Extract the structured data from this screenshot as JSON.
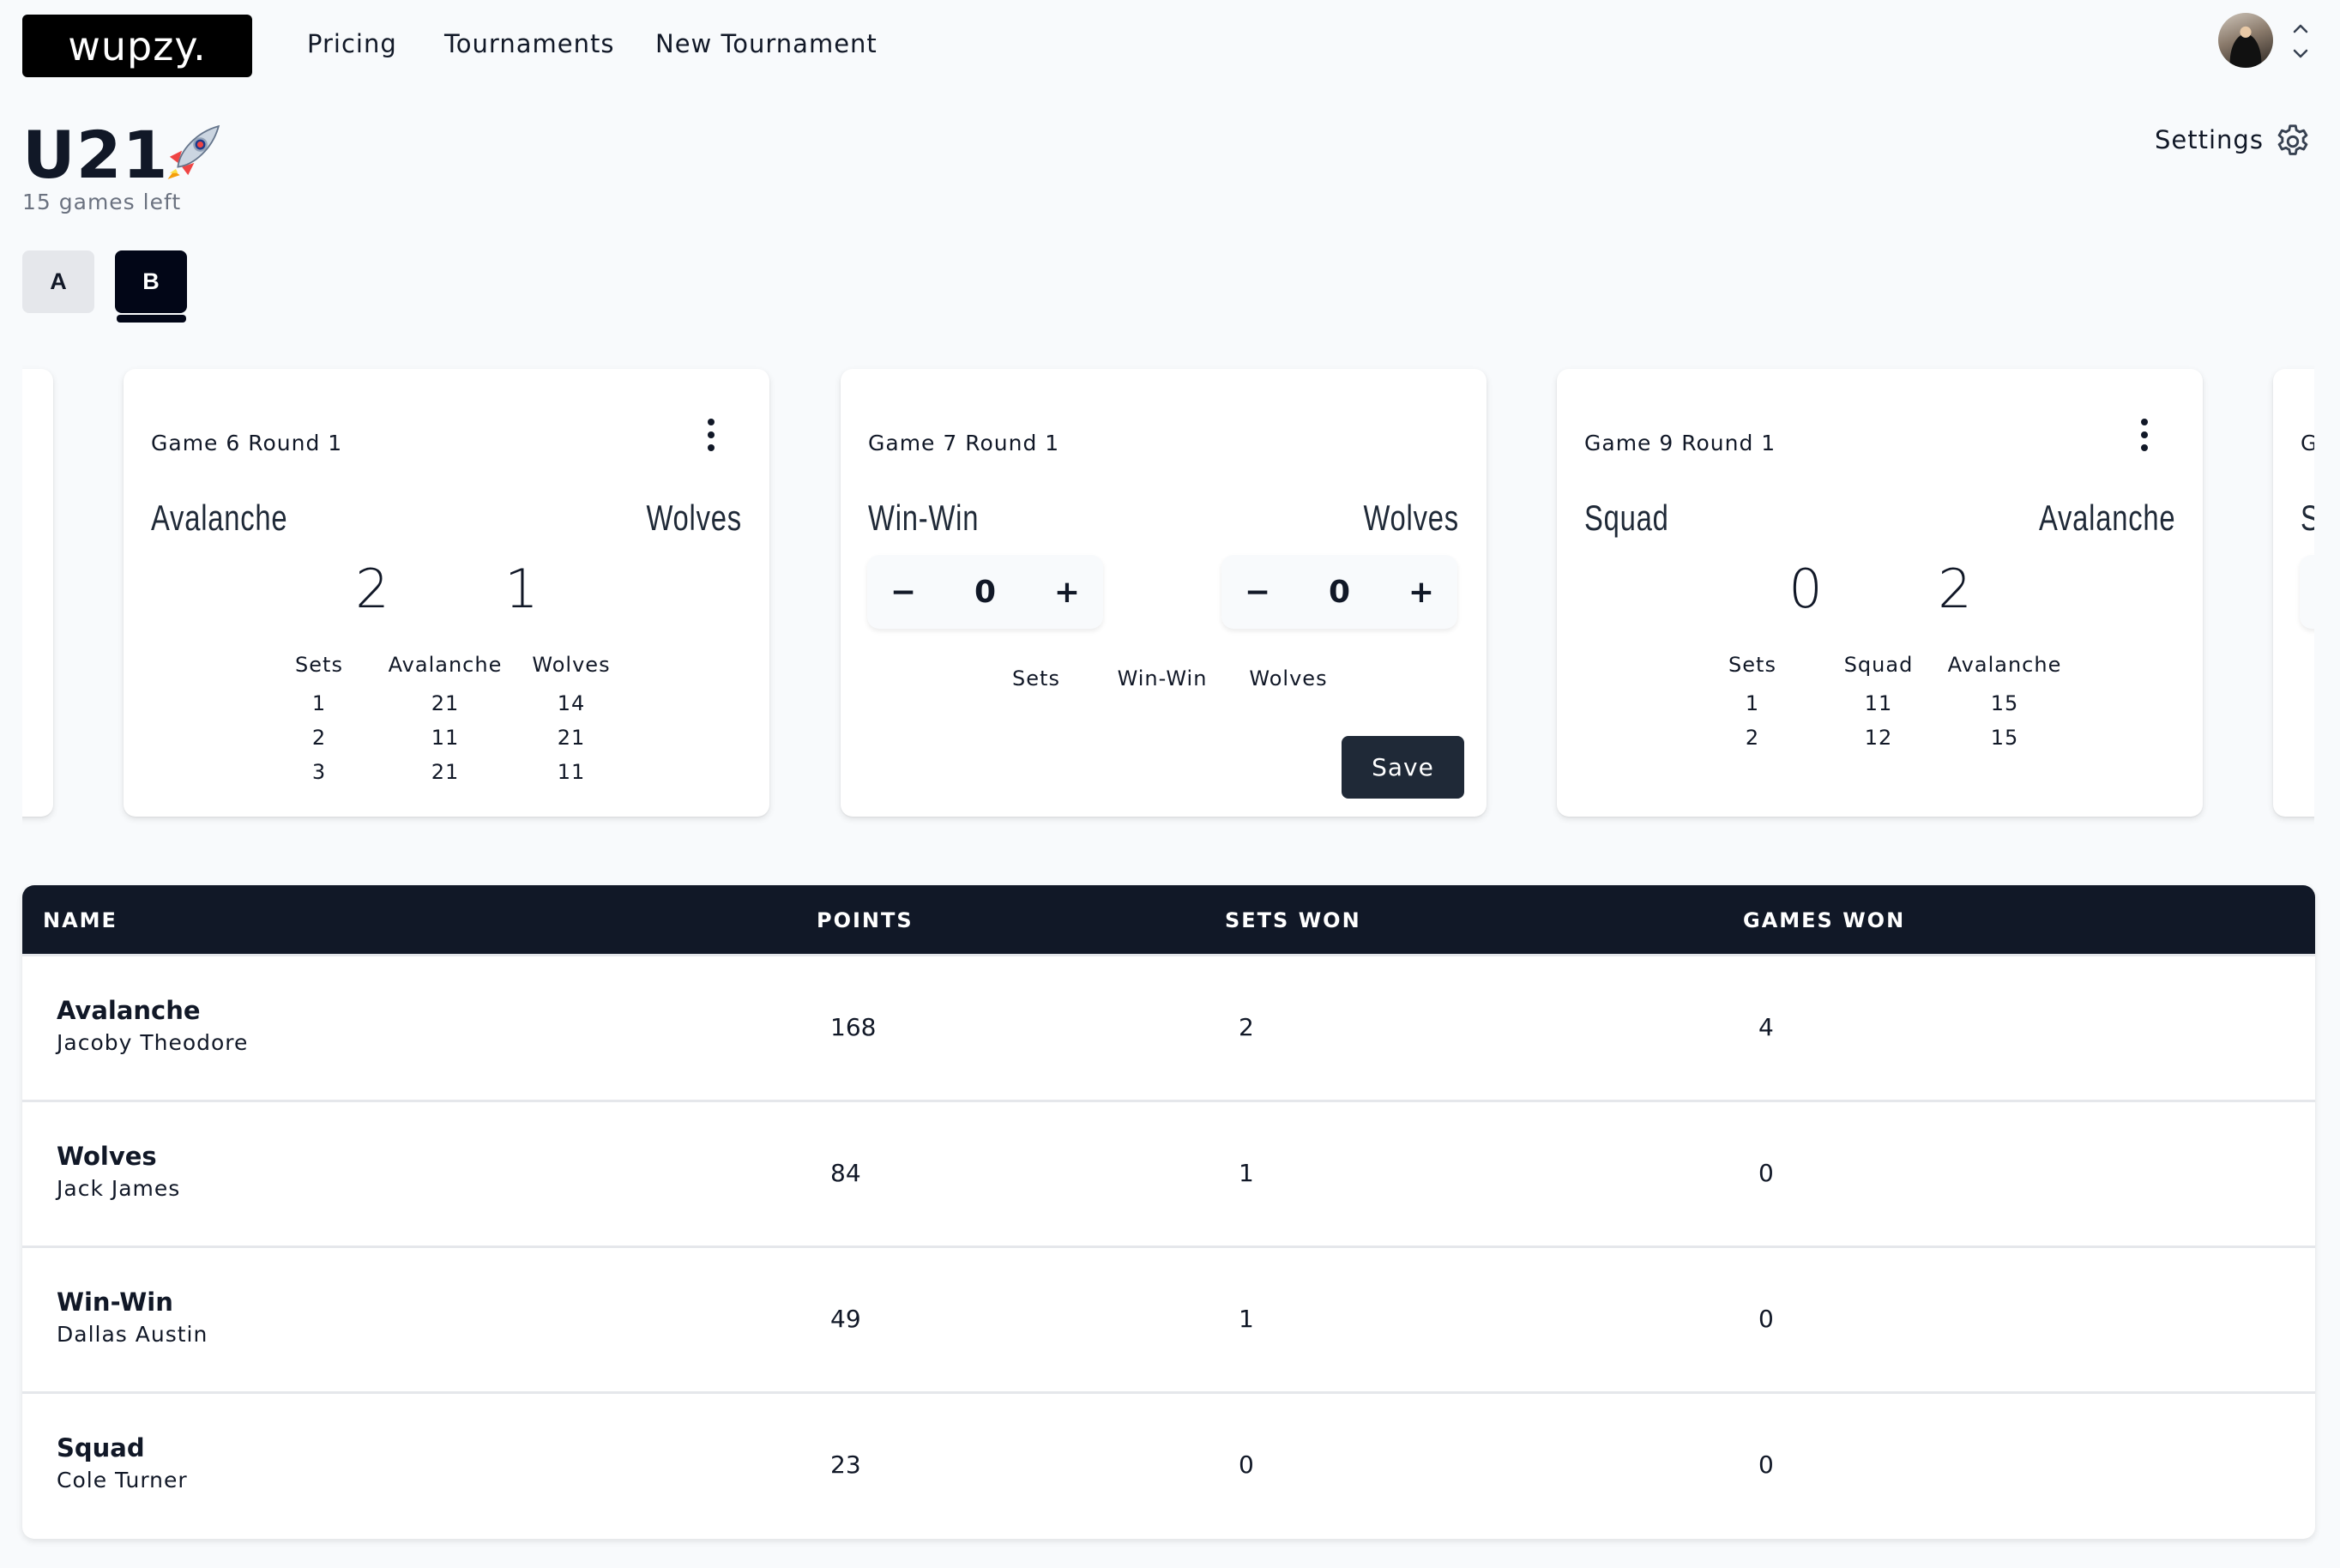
{
  "app": {
    "logo": "wupzy.",
    "nav": [
      "Pricing",
      "Tournaments",
      "New Tournament"
    ],
    "avatar_icon": "user-avatar",
    "account_menu_icons": [
      "chevron-up-icon",
      "chevron-down-icon"
    ]
  },
  "page": {
    "title": "U21",
    "title_emoji": "🚀",
    "subtitle": "15 games left",
    "settings_label": "Settings",
    "settings_icon": "gear-icon"
  },
  "groups": {
    "tabs": [
      {
        "label": "A",
        "active": false
      },
      {
        "label": "B",
        "active": true
      }
    ]
  },
  "games": [
    {
      "title": "Game 6 Round 1",
      "status": "completed",
      "home": "Avalanche",
      "away": "Wolves",
      "home_score": "2",
      "away_score": "1",
      "sets_header": [
        "Sets",
        "Avalanche",
        "Wolves"
      ],
      "sets": [
        [
          "1",
          "21",
          "14"
        ],
        [
          "2",
          "11",
          "21"
        ],
        [
          "3",
          "21",
          "11"
        ]
      ]
    },
    {
      "title": "Game 7 Round 1",
      "status": "pending",
      "home": "Win-Win",
      "away": "Wolves",
      "home_input": "0",
      "away_input": "0",
      "minus": "−",
      "plus": "+",
      "sets_header": [
        "Sets",
        "Win-Win",
        "Wolves"
      ],
      "save_label": "Save"
    },
    {
      "title": "Game 9 Round 1",
      "status": "completed",
      "home": "Squad",
      "away": "Avalanche",
      "home_score": "0",
      "away_score": "2",
      "sets_header": [
        "Sets",
        "Squad",
        "Avalanche"
      ],
      "sets": [
        [
          "1",
          "11",
          "15"
        ],
        [
          "2",
          "12",
          "15"
        ]
      ]
    },
    {
      "title": "G",
      "home": "S"
    }
  ],
  "standings": {
    "columns": [
      "NAME",
      "POINTS",
      "SETS WON",
      "GAMES WON"
    ],
    "rows": [
      {
        "team": "Avalanche",
        "player": "Jacoby Theodore",
        "points": "168",
        "sets_won": "2",
        "games_won": "4"
      },
      {
        "team": "Wolves",
        "player": "Jack James",
        "points": "84",
        "sets_won": "1",
        "games_won": "0"
      },
      {
        "team": "Win-Win",
        "player": "Dallas Austin",
        "points": "49",
        "sets_won": "1",
        "games_won": "0"
      },
      {
        "team": "Squad",
        "player": "Cole Turner",
        "points": "23",
        "sets_won": "0",
        "games_won": "0"
      }
    ]
  },
  "colors": {
    "background": "#f8fafc",
    "primary_dark": "#111827",
    "active_tab": "#020617",
    "save_button": "#1f2937",
    "inactive_tab": "#e5e7eb",
    "muted_text": "#6b7280"
  }
}
